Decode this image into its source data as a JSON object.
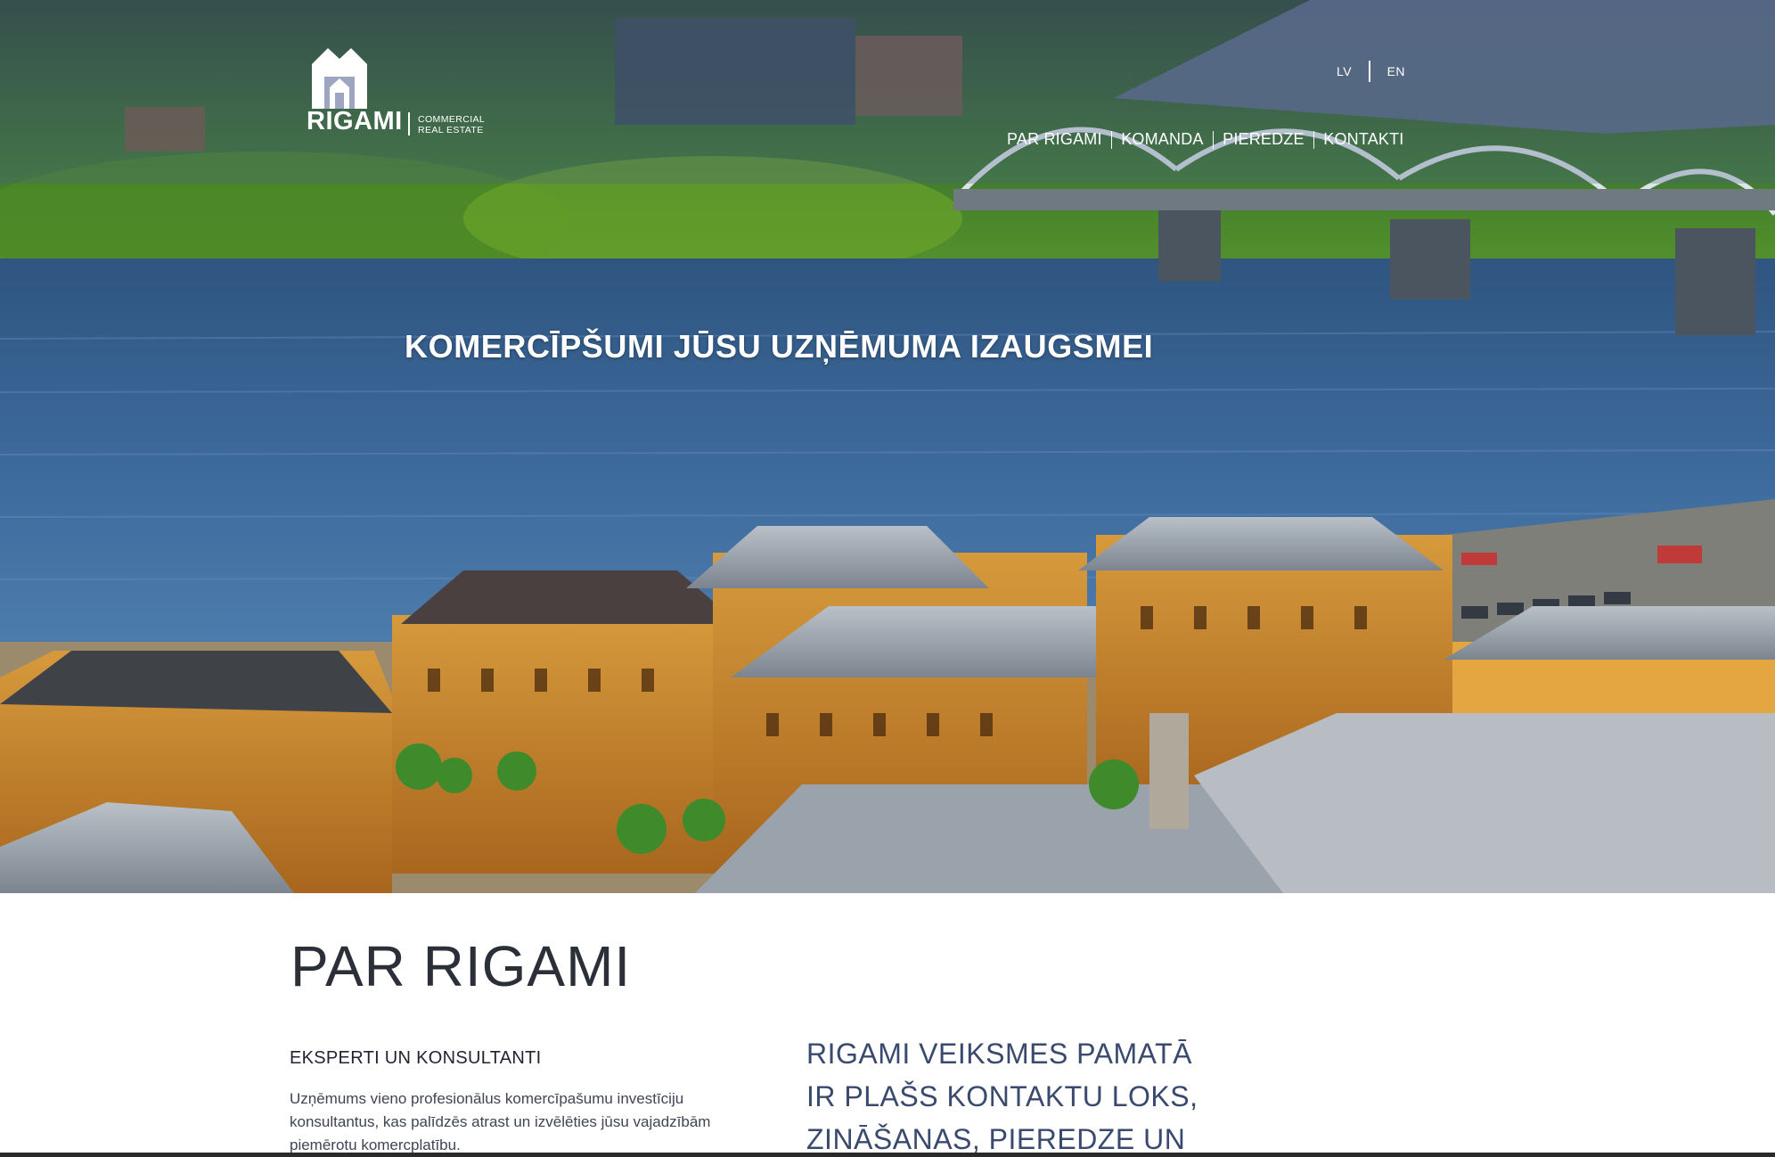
{
  "brand": {
    "name": "RIGAMI",
    "tagline_line1": "COMMERCIAL",
    "tagline_line2": "REAL ESTATE"
  },
  "language_switch": {
    "items": [
      "LV",
      "EN"
    ]
  },
  "nav": {
    "items": [
      "PAR RIGAMI",
      "KOMANDA",
      "PIEREDZE",
      "KONTAKTI"
    ]
  },
  "hero": {
    "title": "KOMERCĪPŠUMI JŪSU UZŅĒMUMA IZAUGSMEI"
  },
  "about": {
    "heading": "PAR RIGAMI",
    "subheading": "EKSPERTI UN KONSULTANTI",
    "body": "Uzņēmums vieno profesionālus komercīpašumu investīciju konsultantus, kas palīdzēs atrast un izvēlēties jūsu vajadzībām piemērotu komercplatību.",
    "lead": "RIGAMI VEIKSMES PAMATĀ IR PLAŠS KONTAKTU LOKS, ZINĀŠANAS, PIEREDZE UN"
  },
  "colors": {
    "header_overlay": "#4c5c8e",
    "heading_text": "#2b2f38",
    "lead_text": "#3a4a6e",
    "body_text": "#3f4555"
  }
}
